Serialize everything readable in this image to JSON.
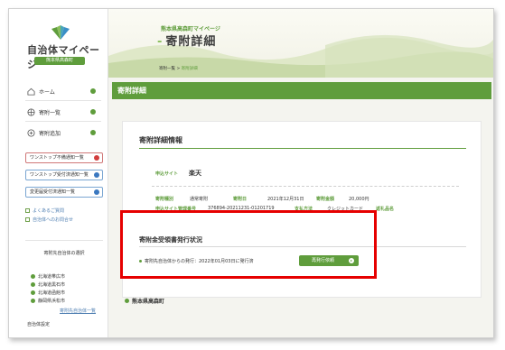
{
  "logo": {
    "title": "自治体マイページ",
    "subtitle": "熊本県高森町"
  },
  "nav": [
    {
      "label": "ホーム",
      "icon": "home-icon"
    },
    {
      "label": "寄附一覧",
      "icon": "gift-icon"
    },
    {
      "label": "寄附追加",
      "icon": "plus-circle-icon"
    }
  ],
  "onestop": [
    {
      "label": "ワンストップ不備通知一覧",
      "color": "#d23c3c"
    },
    {
      "label": "ワンストップ受付済通知一覧",
      "color": "#3a78c0"
    },
    {
      "label": "変更届受付済通知一覧",
      "color": "#3a78c0"
    }
  ],
  "links": [
    {
      "label": "よくあるご質問"
    },
    {
      "label": "自治体へのお問合せ"
    }
  ],
  "municipality": {
    "title": "寄附先自治体の選択",
    "selected": "熊本県高森町",
    "others": [
      "北海道帯広市",
      "北海道黒石市",
      "北海道函館市",
      "静岡県浜松市"
    ],
    "list_link": "寄附先自治体一覧"
  },
  "banner": {
    "subtitle": "熊本県高森町マイページ",
    "title": "寄附詳細",
    "dash": "-"
  },
  "breadcrumb": {
    "parent": "寄附一覧",
    "separator": ">",
    "current": "寄附詳細"
  },
  "section": {
    "title": "寄附詳細"
  },
  "detail": {
    "card_title": "寄附詳細情報",
    "site_label": "申込サイト",
    "site_value": "楽天",
    "type_label": "寄附種別",
    "type_value": "通常寄附",
    "date_label": "寄附日",
    "date_value": "2021年12月31日",
    "amount_label": "寄附金額",
    "amount_value": "20,000円",
    "mgmt_label": "申込サイト管理番号",
    "mgmt_value": "376894-20211231-01201719",
    "payment_label": "支払方法",
    "payment_value": "クレジットカード",
    "gift_label": "返礼品名",
    "gift_value": ""
  },
  "receipt": {
    "title": "寄附金受領書発行状況",
    "status": "寄附先自治体からの発行：2022年01月03日に発行済",
    "button": "再発行依頼"
  },
  "bottom": {
    "label": "自治体設定"
  }
}
